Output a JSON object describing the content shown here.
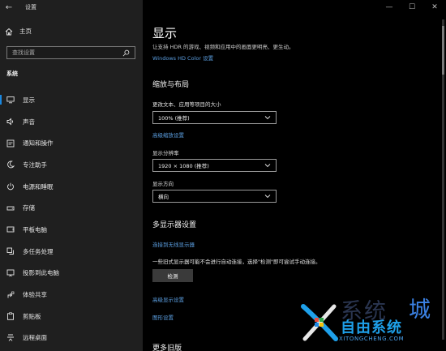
{
  "window": {
    "title": "设置",
    "back_glyph": "←",
    "controls": {
      "minimize": "—",
      "maximize": "☐",
      "close": "✕"
    }
  },
  "sidebar": {
    "home_label": "主页",
    "search_placeholder": "查找设置",
    "section_label": "系统",
    "items": [
      {
        "label": "显示",
        "icon": "monitor-icon",
        "active": true
      },
      {
        "label": "声音",
        "icon": "speaker-icon"
      },
      {
        "label": "通知和操作",
        "icon": "notification-icon"
      },
      {
        "label": "专注助手",
        "icon": "moon-icon"
      },
      {
        "label": "电源和睡眠",
        "icon": "power-icon"
      },
      {
        "label": "存储",
        "icon": "storage-icon"
      },
      {
        "label": "平板电脑",
        "icon": "tablet-icon"
      },
      {
        "label": "多任务处理",
        "icon": "multitask-icon"
      },
      {
        "label": "投影到此电脑",
        "icon": "project-icon"
      },
      {
        "label": "体验共享",
        "icon": "share-icon"
      },
      {
        "label": "剪贴板",
        "icon": "clipboard-icon"
      },
      {
        "label": "远程桌面",
        "icon": "remote-desktop-icon"
      }
    ]
  },
  "main": {
    "title": "显示",
    "description": "让支持 HDR 的游戏、视频和应用中的画面更明亮、更生动。",
    "hdr_link": "Windows HD Color 设置",
    "scale_layout_heading": "缩放与布局",
    "scale_label": "更改文本、应用等项目的大小",
    "scale_value": "100% (推荐)",
    "advanced_scaling_link": "高级缩放设置",
    "resolution_label": "显示分辨率",
    "resolution_value": "1920 × 1080 (推荐)",
    "orientation_label": "显示方向",
    "orientation_value": "横向",
    "multi_display_heading": "多显示器设置",
    "wireless_link": "连接到无线显示器",
    "detect_hint": "一些旧式显示器可能不会进行自动连接，选择\"检测\"即可尝试手动连接。",
    "detect_button": "检测",
    "advanced_display_link": "高级显示设置",
    "graphics_link": "图形设置",
    "next_heading": "更多旧版"
  },
  "watermark": {
    "line1": "系统",
    "line1_accent": "城",
    "line2": "自由系统",
    "url": "XITONGCHENG.COM"
  },
  "colors": {
    "accent": "#1a88e0",
    "link": "#5b9ee0",
    "sidebar_bg": "#1f1f1f",
    "main_bg": "#000000"
  }
}
